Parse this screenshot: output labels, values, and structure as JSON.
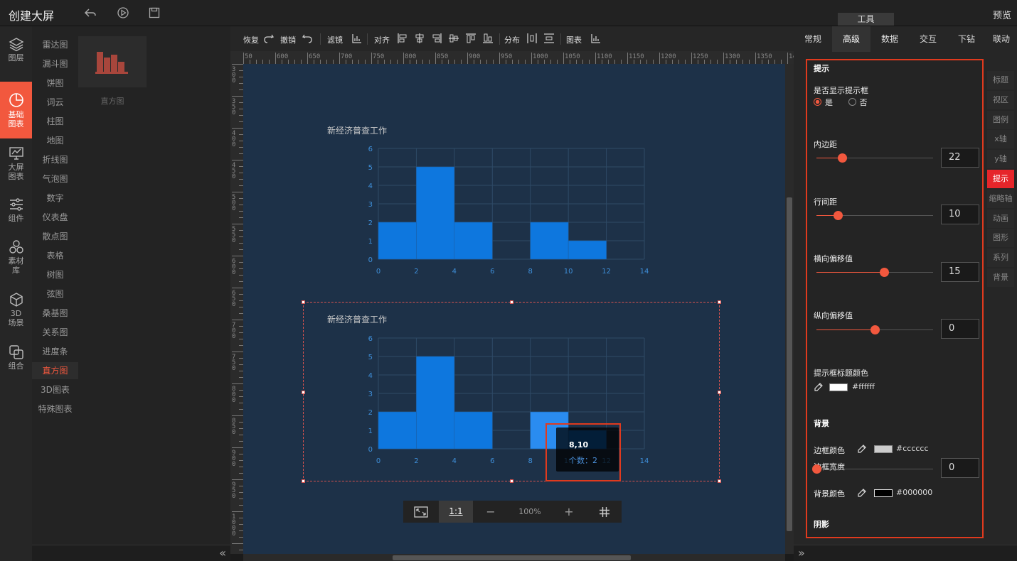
{
  "app": {
    "title": "创建大屏",
    "preview": "预览",
    "tools_tab": "工具"
  },
  "rail": [
    {
      "label": "图层",
      "icon": "layers-icon"
    },
    {
      "label": "基础图表",
      "icon": "pie-chart-icon",
      "active": true
    },
    {
      "label": "大屏图表",
      "icon": "monitor-chart-icon"
    },
    {
      "label": "组件",
      "icon": "sliders-icon"
    },
    {
      "label": "素材库",
      "icon": "hexagons-icon"
    },
    {
      "label": "3D场景",
      "icon": "cube-icon"
    },
    {
      "label": "组合",
      "icon": "combine-icon"
    }
  ],
  "chart_types": [
    "雷达图",
    "漏斗图",
    "饼图",
    "词云",
    "柱图",
    "地图",
    "折线图",
    "气泡图",
    "数字",
    "仪表盘",
    "散点图",
    "表格",
    "树图",
    "弦图",
    "桑基图",
    "关系图",
    "进度条",
    "直方图",
    "3D图表",
    "特殊图表"
  ],
  "active_chart_type": "直方图",
  "thumbnail": {
    "label": "直方图"
  },
  "toolbar": {
    "redo": "恢复",
    "undo": "撤销",
    "filter": "滤镜",
    "align": "对齐",
    "distribute": "分布",
    "chart": "图表"
  },
  "ruler": {
    "top_labels": [
      "50",
      "600",
      "650",
      "700",
      "750",
      "800",
      "850",
      "900",
      "950",
      "1000",
      "1050",
      "1100",
      "1150",
      "1200",
      "1250",
      "1300",
      "1350",
      "1400"
    ],
    "left_labels": [
      "300",
      "350",
      "400",
      "450",
      "500",
      "550",
      "600",
      "650",
      "700",
      "750",
      "800",
      "850",
      "900",
      "950",
      "1000"
    ]
  },
  "charts": [
    {
      "title": "新经济普查工作"
    },
    {
      "title": "新经济普查工作"
    }
  ],
  "chart_data": [
    {
      "type": "bar",
      "title": "新经济普查工作",
      "bins": [
        [
          0,
          2
        ],
        [
          2,
          4
        ],
        [
          4,
          6
        ],
        [
          6,
          8
        ],
        [
          8,
          10
        ],
        [
          10,
          12
        ]
      ],
      "values": [
        2,
        5,
        2,
        0,
        2,
        1
      ],
      "xticks": [
        0,
        2,
        4,
        6,
        8,
        10,
        12,
        14
      ],
      "yticks": [
        0,
        1,
        2,
        3,
        4,
        5,
        6
      ],
      "xlim": [
        0,
        14
      ],
      "ylim": [
        0,
        6
      ],
      "grid": true,
      "color": "#0e77de"
    },
    {
      "type": "bar",
      "title": "新经济普查工作",
      "bins": [
        [
          0,
          2
        ],
        [
          2,
          4
        ],
        [
          4,
          6
        ],
        [
          6,
          8
        ],
        [
          8,
          10
        ],
        [
          10,
          12
        ]
      ],
      "values": [
        2,
        5,
        2,
        0,
        2,
        1
      ],
      "xticks": [
        0,
        2,
        4,
        6,
        8,
        10,
        12,
        14
      ],
      "yticks": [
        0,
        1,
        2,
        3,
        4,
        5,
        6
      ],
      "xlim": [
        0,
        14
      ],
      "ylim": [
        0,
        6
      ],
      "grid": true,
      "color": "#0e77de",
      "highlight_color": "#2a8cf0"
    }
  ],
  "tooltip": {
    "title": "8,10",
    "body": "个数：2"
  },
  "zoom": {
    "ratio": "1:1",
    "minus": "−",
    "percent": "100%",
    "plus": "+"
  },
  "tabs": [
    "常规",
    "高级",
    "数据",
    "交互",
    "下钻",
    "联动"
  ],
  "active_tab": "高级",
  "settings": {
    "section_title": "提示",
    "show_label": "是否显示提示框",
    "yes": "是",
    "no": "否",
    "padding": {
      "label": "内边距",
      "value": "22",
      "fraction": 0.22
    },
    "line_spacing": {
      "label": "行间距",
      "value": "10",
      "fraction": 0.18
    },
    "x_offset": {
      "label": "横向偏移值",
      "value": "15",
      "fraction": 0.58
    },
    "y_offset": {
      "label": "纵向偏移值",
      "value": "0",
      "fraction": 0.5
    },
    "title_color": {
      "label": "提示框标题颜色",
      "value": "#ffffff"
    },
    "bg_section": "背景",
    "border_color": {
      "label": "边框颜色",
      "value": "#cccccc"
    },
    "border_width": {
      "label": "边框宽度",
      "value": "0",
      "fraction": 0.0
    },
    "bg_color": {
      "label": "背景颜色",
      "value": "#000000"
    },
    "shadow_section": "阴影"
  },
  "side_tabs": [
    "标题",
    "视区",
    "图例",
    "x轴",
    "y轴",
    "提示",
    "缩略轴",
    "动画",
    "图形",
    "系列",
    "背景"
  ],
  "active_side_tab": "提示",
  "colors": {
    "accent": "#f2583e",
    "canvas": "#1d3148",
    "bar": "#0e77de",
    "highlight_border": "#e03a1e"
  }
}
